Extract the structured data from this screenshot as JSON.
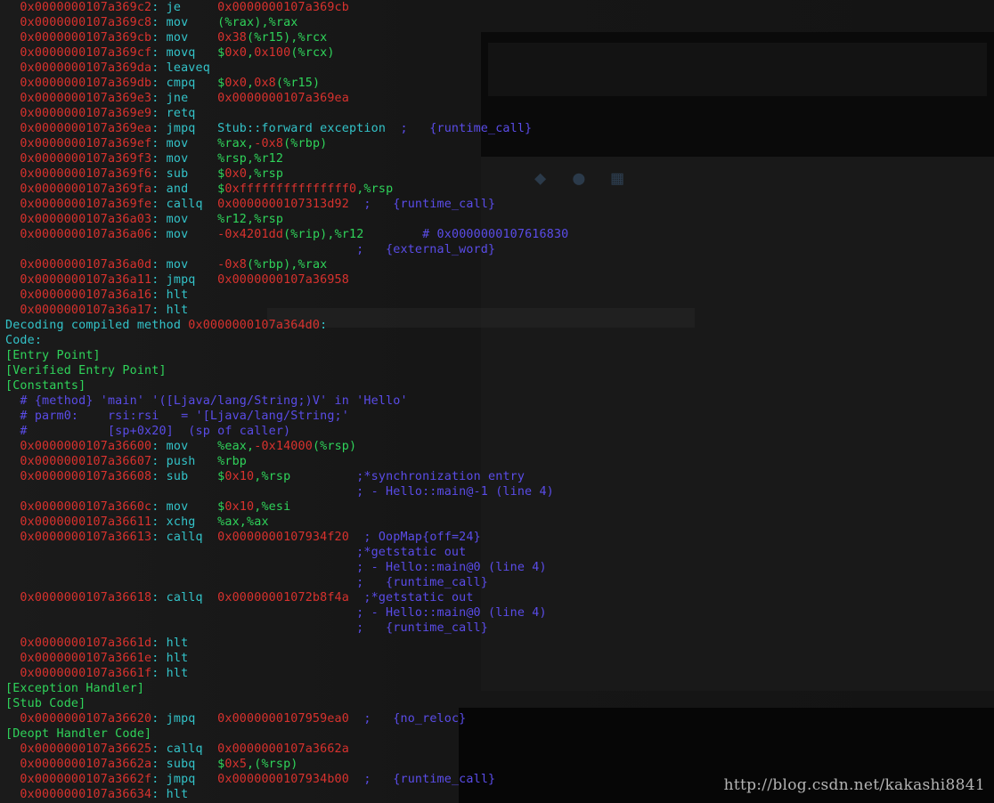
{
  "terminal": {
    "lines": [
      [
        [
          "t-addr",
          "  0x0000000107a369c2"
        ],
        [
          "t-mn",
          ": je     "
        ],
        [
          "t-imm",
          "0x0000000107a369cb"
        ]
      ],
      [
        [
          "t-addr",
          "  0x0000000107a369c8"
        ],
        [
          "t-mn",
          ": mov    "
        ],
        [
          "t-reg",
          "(%rax),%rax"
        ]
      ],
      [
        [
          "t-addr",
          "  0x0000000107a369cb"
        ],
        [
          "t-mn",
          ": mov    "
        ],
        [
          "t-imm",
          "0x38"
        ],
        [
          "t-reg",
          "(%r15),%rcx"
        ]
      ],
      [
        [
          "t-addr",
          "  0x0000000107a369cf"
        ],
        [
          "t-mn",
          ": movq   "
        ],
        [
          "t-reg",
          "$"
        ],
        [
          "t-imm",
          "0x0"
        ],
        [
          "t-reg",
          ","
        ],
        [
          "t-imm",
          "0x100"
        ],
        [
          "t-reg",
          "(%rcx)"
        ]
      ],
      [
        [
          "t-addr",
          "  0x0000000107a369da"
        ],
        [
          "t-mn",
          ": leaveq"
        ]
      ],
      [
        [
          "t-addr",
          "  0x0000000107a369db"
        ],
        [
          "t-mn",
          ": cmpq   "
        ],
        [
          "t-reg",
          "$"
        ],
        [
          "t-imm",
          "0x0"
        ],
        [
          "t-reg",
          ","
        ],
        [
          "t-imm",
          "0x8"
        ],
        [
          "t-reg",
          "(%r15)"
        ]
      ],
      [
        [
          "t-addr",
          "  0x0000000107a369e3"
        ],
        [
          "t-mn",
          ": jne    "
        ],
        [
          "t-imm",
          "0x0000000107a369ea"
        ]
      ],
      [
        [
          "t-addr",
          "  0x0000000107a369e9"
        ],
        [
          "t-mn",
          ": retq"
        ]
      ],
      [
        [
          "t-addr",
          "  0x0000000107a369ea"
        ],
        [
          "t-mn",
          ": jmpq   Stub::forward exception  "
        ],
        [
          "t-com",
          ";   {runtime_call}"
        ]
      ],
      [
        [
          "t-addr",
          "  0x0000000107a369ef"
        ],
        [
          "t-mn",
          ": mov    "
        ],
        [
          "t-reg",
          "%rax,"
        ],
        [
          "t-imm",
          "-0x8"
        ],
        [
          "t-reg",
          "(%rbp)"
        ]
      ],
      [
        [
          "t-addr",
          "  0x0000000107a369f3"
        ],
        [
          "t-mn",
          ": mov    "
        ],
        [
          "t-reg",
          "%rsp,%r12"
        ]
      ],
      [
        [
          "t-addr",
          "  0x0000000107a369f6"
        ],
        [
          "t-mn",
          ": sub    "
        ],
        [
          "t-reg",
          "$"
        ],
        [
          "t-imm",
          "0x0"
        ],
        [
          "t-reg",
          ",%rsp"
        ]
      ],
      [
        [
          "t-addr",
          "  0x0000000107a369fa"
        ],
        [
          "t-mn",
          ": and    "
        ],
        [
          "t-reg",
          "$"
        ],
        [
          "t-imm",
          "0xfffffffffffffff0"
        ],
        [
          "t-reg",
          ",%rsp"
        ]
      ],
      [
        [
          "t-addr",
          "  0x0000000107a369fe"
        ],
        [
          "t-mn",
          ": callq  "
        ],
        [
          "t-imm",
          "0x0000000107313d92"
        ],
        [
          "t-com",
          "  ;   {runtime_call}"
        ]
      ],
      [
        [
          "t-addr",
          "  0x0000000107a36a03"
        ],
        [
          "t-mn",
          ": mov    "
        ],
        [
          "t-reg",
          "%r12,%rsp"
        ]
      ],
      [
        [
          "t-addr",
          "  0x0000000107a36a06"
        ],
        [
          "t-mn",
          ": mov    "
        ],
        [
          "t-imm",
          "-0x4201dd"
        ],
        [
          "t-reg",
          "(%rip),%r12"
        ],
        [
          "t-com",
          "        # 0x0000000107616830"
        ]
      ],
      [
        [
          "t-com",
          "                                                ;   {external_word}"
        ]
      ],
      [
        [
          "t-addr",
          "  0x0000000107a36a0d"
        ],
        [
          "t-mn",
          ": mov    "
        ],
        [
          "t-imm",
          "-0x8"
        ],
        [
          "t-reg",
          "(%rbp),%rax"
        ]
      ],
      [
        [
          "t-addr",
          "  0x0000000107a36a11"
        ],
        [
          "t-mn",
          ": jmpq   "
        ],
        [
          "t-imm",
          "0x0000000107a36958"
        ]
      ],
      [
        [
          "t-addr",
          "  0x0000000107a36a16"
        ],
        [
          "t-mn",
          ": hlt"
        ]
      ],
      [
        [
          "t-addr",
          "  0x0000000107a36a17"
        ],
        [
          "t-mn",
          ": hlt"
        ]
      ],
      [
        [
          "t-txt",
          "Decoding compiled method "
        ],
        [
          "t-imm",
          "0x0000000107a364d0"
        ],
        [
          "t-txt",
          ":"
        ]
      ],
      [
        [
          "t-txt",
          "Code:"
        ]
      ],
      [
        [
          "t-sec",
          "[Entry Point]"
        ]
      ],
      [
        [
          "t-sec",
          "[Verified Entry Point]"
        ]
      ],
      [
        [
          "t-sec",
          "[Constants]"
        ]
      ],
      [
        [
          "t-com",
          "  # {method} 'main' '([Ljava/lang/String;)V' in 'Hello'"
        ]
      ],
      [
        [
          "t-com",
          "  # parm0:    rsi:rsi   = '[Ljava/lang/String;'"
        ]
      ],
      [
        [
          "t-com",
          "  #           [sp+0x20]  (sp of caller)"
        ]
      ],
      [
        [
          "t-addr",
          "  0x0000000107a36600"
        ],
        [
          "t-mn",
          ": mov    "
        ],
        [
          "t-reg",
          "%eax,"
        ],
        [
          "t-imm",
          "-0x14000"
        ],
        [
          "t-reg",
          "(%rsp)"
        ]
      ],
      [
        [
          "t-addr",
          "  0x0000000107a36607"
        ],
        [
          "t-mn",
          ": push   "
        ],
        [
          "t-reg",
          "%rbp"
        ]
      ],
      [
        [
          "t-addr",
          "  0x0000000107a36608"
        ],
        [
          "t-mn",
          ": sub    "
        ],
        [
          "t-reg",
          "$"
        ],
        [
          "t-imm",
          "0x10"
        ],
        [
          "t-reg",
          ",%rsp"
        ],
        [
          "t-com",
          "         ;*synchronization entry"
        ]
      ],
      [
        [
          "t-com",
          "                                                ; - Hello::main@-1 (line 4)"
        ]
      ],
      [
        [
          "t-addr",
          "  0x0000000107a3660c"
        ],
        [
          "t-mn",
          ": mov    "
        ],
        [
          "t-reg",
          "$"
        ],
        [
          "t-imm",
          "0x10"
        ],
        [
          "t-reg",
          ",%esi"
        ]
      ],
      [
        [
          "t-addr",
          "  0x0000000107a36611"
        ],
        [
          "t-mn",
          ": xchg   "
        ],
        [
          "t-reg",
          "%ax,%ax"
        ]
      ],
      [
        [
          "t-addr",
          "  0x0000000107a36613"
        ],
        [
          "t-mn",
          ": callq  "
        ],
        [
          "t-imm",
          "0x0000000107934f20"
        ],
        [
          "t-com",
          "  ; OopMap{off=24}"
        ]
      ],
      [
        [
          "t-com",
          "                                                ;*getstatic out"
        ]
      ],
      [
        [
          "t-com",
          "                                                ; - Hello::main@0 (line 4)"
        ]
      ],
      [
        [
          "t-com",
          "                                                ;   {runtime_call}"
        ]
      ],
      [
        [
          "t-addr",
          "  0x0000000107a36618"
        ],
        [
          "t-mn",
          ": callq  "
        ],
        [
          "t-imm",
          "0x00000001072b8f4a"
        ],
        [
          "t-com",
          "  ;*getstatic out"
        ]
      ],
      [
        [
          "t-com",
          "                                                ; - Hello::main@0 (line 4)"
        ]
      ],
      [
        [
          "t-com",
          "                                                ;   {runtime_call}"
        ]
      ],
      [
        [
          "t-addr",
          "  0x0000000107a3661d"
        ],
        [
          "t-mn",
          ": hlt"
        ]
      ],
      [
        [
          "t-addr",
          "  0x0000000107a3661e"
        ],
        [
          "t-mn",
          ": hlt"
        ]
      ],
      [
        [
          "t-addr",
          "  0x0000000107a3661f"
        ],
        [
          "t-mn",
          ": hlt"
        ]
      ],
      [
        [
          "t-sec",
          "[Exception Handler]"
        ]
      ],
      [
        [
          "t-sec",
          "[Stub Code]"
        ]
      ],
      [
        [
          "t-addr",
          "  0x0000000107a36620"
        ],
        [
          "t-mn",
          ": jmpq   "
        ],
        [
          "t-imm",
          "0x0000000107959ea0"
        ],
        [
          "t-com",
          "  ;   {no_reloc}"
        ]
      ],
      [
        [
          "t-sec",
          "[Deopt Handler Code]"
        ]
      ],
      [
        [
          "t-addr",
          "  0x0000000107a36625"
        ],
        [
          "t-mn",
          ": callq  "
        ],
        [
          "t-imm",
          "0x0000000107a3662a"
        ]
      ],
      [
        [
          "t-addr",
          "  0x0000000107a3662a"
        ],
        [
          "t-mn",
          ": subq   "
        ],
        [
          "t-reg",
          "$"
        ],
        [
          "t-imm",
          "0x5"
        ],
        [
          "t-reg",
          ",(%rsp)"
        ]
      ],
      [
        [
          "t-addr",
          "  0x0000000107a3662f"
        ],
        [
          "t-mn",
          ": jmpq   "
        ],
        [
          "t-imm",
          "0x0000000107934b00"
        ],
        [
          "t-com",
          "  ;   {runtime_call}"
        ]
      ],
      [
        [
          "t-addr",
          "  0x0000000107a36634"
        ],
        [
          "t-mn",
          ": hlt"
        ]
      ]
    ]
  },
  "watermark": {
    "text": "http://blog.csdn.net/kakashi8841"
  },
  "background": {
    "icons": [
      "shield-icon",
      "person-icon",
      "grid-icon"
    ]
  }
}
